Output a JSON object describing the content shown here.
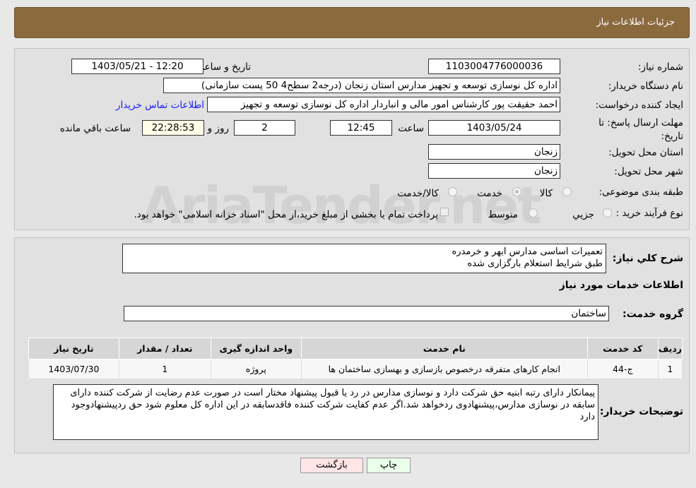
{
  "header": {
    "title": "جزئیات اطلاعات نیاز"
  },
  "form": {
    "need_number_label": "شماره نیاز:",
    "need_number": "1103004776000036",
    "announce_label": "تاریخ و ساعت اعلان عمومي:",
    "announce_value": "1403/05/21 - 12:20",
    "buyer_label": "نام دستگاه خریدار:",
    "buyer_value": "اداره کل نوسازی   توسعه و تجهیز مدارس استان زنجان (درجه2  سطح4  50 پست سازمانی)",
    "creator_label": "ایجاد کننده درخواست:",
    "creator_value": "احمد حقیقت پور کارشناس امور مالی و انباردار اداره کل نوسازی   توسعه و تجهیز",
    "contact_link": "اطلاعات تماس خریدار",
    "deadline_label": "مهلت ارسال پاسخ: تا تاریخ:",
    "deadline_date": "1403/05/24",
    "time_label": "ساعت",
    "deadline_time": "12:45",
    "days": "2",
    "days_label": "روز و",
    "remaining": "22:28:53",
    "remaining_label": "ساعت باقي مانده",
    "province_label": "استان محل تحویل:",
    "province": "زنجان",
    "city_label": "شهر محل تحویل:",
    "city": "زنجان",
    "category_label": "طبقه بندی موضوعی:",
    "category_options": [
      "کالا",
      "خدمت",
      "کالا/خدمت"
    ],
    "category_selected": "خدمت",
    "process_label": "نوع فرآیند خرید :",
    "process_options": [
      "جزيي",
      "متوسط"
    ],
    "payment_note": "پرداخت تمام یا بخشی از مبلغ خرید،از محل \"اسناد خزانه اسلامی\" خواهد بود."
  },
  "description": {
    "label": "شرح کلي نیاز:",
    "lines": [
      "تعمیرات اساسی مدارس ابهر و خرمدره",
      "طبق شرایط استعلام بارگزاری شده"
    ]
  },
  "services": {
    "title": "اطلاعات خدمات مورد نیاز",
    "group_label": "گروه خدمت:",
    "group_value": "ساختمان",
    "columns": [
      "ردیف",
      "کد خدمت",
      "نام خدمت",
      "واحد اندازه گیری",
      "تعداد / مقدار",
      "تاریخ نیاز"
    ],
    "rows": [
      [
        "1",
        "ج-44",
        "انجام کارهای متفرقه درخصوص بازسازی و بهسازی ساختمان ها",
        "پروژه",
        "1",
        "1403/07/30"
      ]
    ]
  },
  "buyer_notes": {
    "label": "توضیحات خریدار:",
    "text": "پیمانکار دارای رتبه ابنیه حق شرکت دارد و نوسازی مدارس در رد یا قبول پیشنهاد مختار است در صورت عدم رضایت از شرکت کننده دارای سابقه در نوسازی مدارس،پیشنهادوی ردخواهد شد.اگر عدم کفایت شرکت کننده فاقدسابقه در این اداره کل معلوم شود حق ردپیشنهادوجود دارد"
  },
  "buttons": {
    "print": "چاپ",
    "back": "بازگشت"
  },
  "watermark": "AriaTender.net"
}
